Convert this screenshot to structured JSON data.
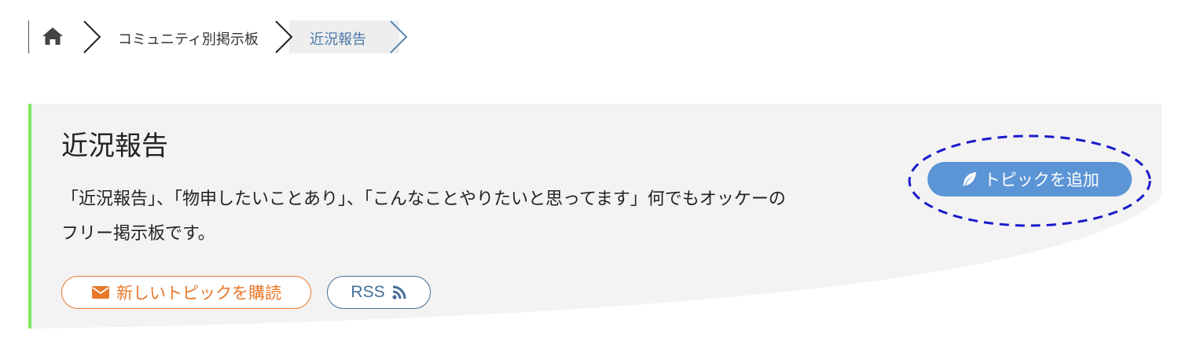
{
  "breadcrumb": {
    "home_icon": "home-icon",
    "community_label": "コミュニティ別掲示板",
    "current_label": "近況報告"
  },
  "board": {
    "title": "近況報告",
    "description": "「近況報告」、「物申したいことあり」、「こんなことやりたいと思ってます」何でもオッケーのフリー掲示板です。",
    "subscribe_label": "新しいトピックを購読",
    "subscribe_icon": "envelope-icon",
    "rss_label": "RSS",
    "rss_icon": "rss-icon",
    "add_topic_label": "トピックを追加",
    "add_topic_icon": "feather-icon"
  },
  "colors": {
    "accent_green": "#7ce85e",
    "add_button": "#5b95d6",
    "subscribe": "#e8782a",
    "rss": "#456f98",
    "highlight": "#1a1acc"
  }
}
